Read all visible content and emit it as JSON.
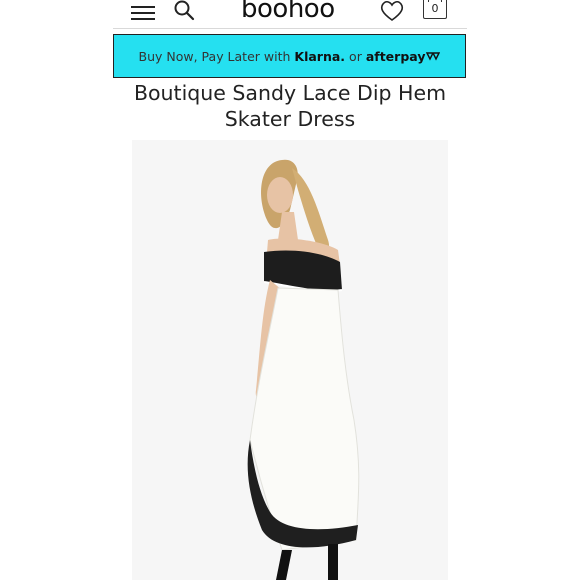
{
  "header": {
    "logo": "boohoo",
    "bag_count": "0"
  },
  "banner": {
    "prefix": "Buy Now, Pay Later with",
    "klarna": "Klarna.",
    "or": "or",
    "afterpay": "afterpay"
  },
  "product": {
    "title_line1": "Boutique Sandy Lace Dip Hem",
    "title_line2": "Skater Dress"
  },
  "icons": {
    "menu": "menu-icon",
    "search": "search-icon",
    "heart": "heart-icon",
    "bag": "bag-icon",
    "afterpay_logo": "afterpay-arrow-icon"
  }
}
